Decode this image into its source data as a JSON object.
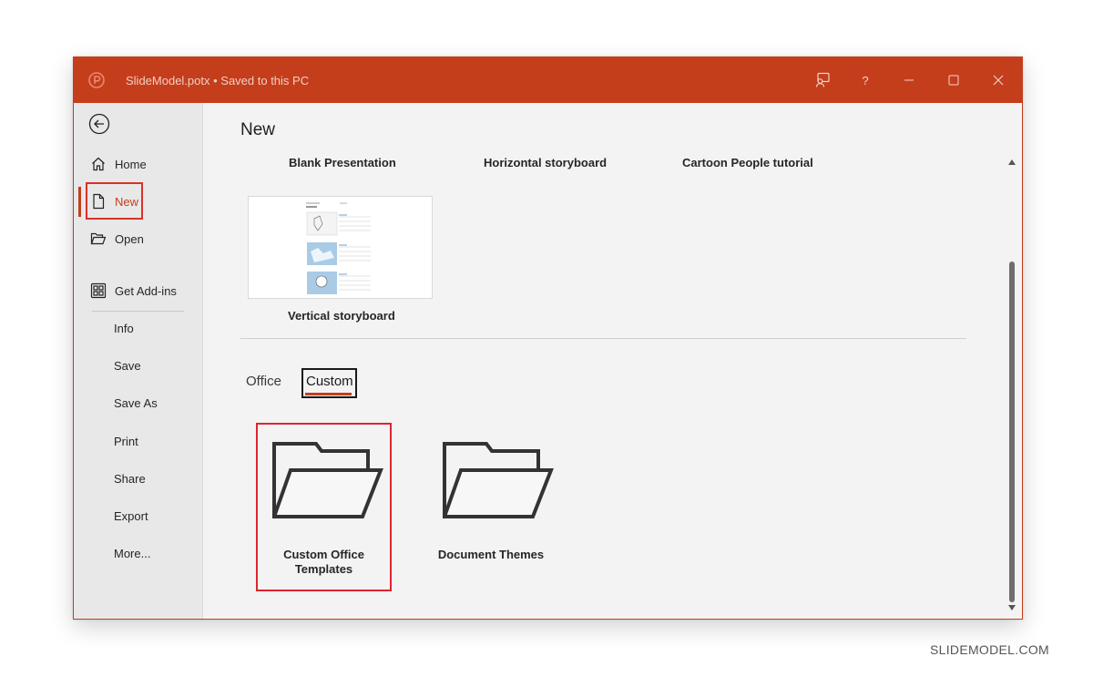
{
  "window": {
    "title": "SlideModel.potx • Saved to this PC",
    "accent_color": "#c43e1c",
    "buttons": [
      "coauthor-icon",
      "help-icon",
      "minimize-icon",
      "maximize-icon",
      "close-icon"
    ],
    "help_label": "?"
  },
  "sidebar": {
    "items": [
      {
        "label": "Home",
        "icon": "home-icon"
      },
      {
        "label": "New",
        "icon": "new-document-icon",
        "active": true
      },
      {
        "label": "Open",
        "icon": "open-folder-icon"
      },
      {
        "label": "Get Add-ins",
        "icon": "add-ins-grid-icon"
      },
      {
        "label": "Info"
      },
      {
        "label": "Save"
      },
      {
        "label": "Save As"
      },
      {
        "label": "Print"
      },
      {
        "label": "Share"
      },
      {
        "label": "Export"
      },
      {
        "label": "More..."
      }
    ]
  },
  "main": {
    "title": "New",
    "templates_row1": [
      "Blank Presentation",
      "Horizontal storyboard",
      "Cartoon People tutorial"
    ],
    "template_thumb_label": "Vertical storyboard",
    "tabs": [
      {
        "label": "Office",
        "selected": false
      },
      {
        "label": "Custom",
        "selected": true
      }
    ],
    "folders": [
      {
        "label": "Custom Office Templates",
        "line1": "Custom Office",
        "line2": "Templates",
        "icon": "folder-open-icon",
        "selected": true
      },
      {
        "label": "Document Themes",
        "icon": "folder-open-icon",
        "selected": false
      }
    ]
  },
  "watermark": "SLIDEMODEL.COM"
}
